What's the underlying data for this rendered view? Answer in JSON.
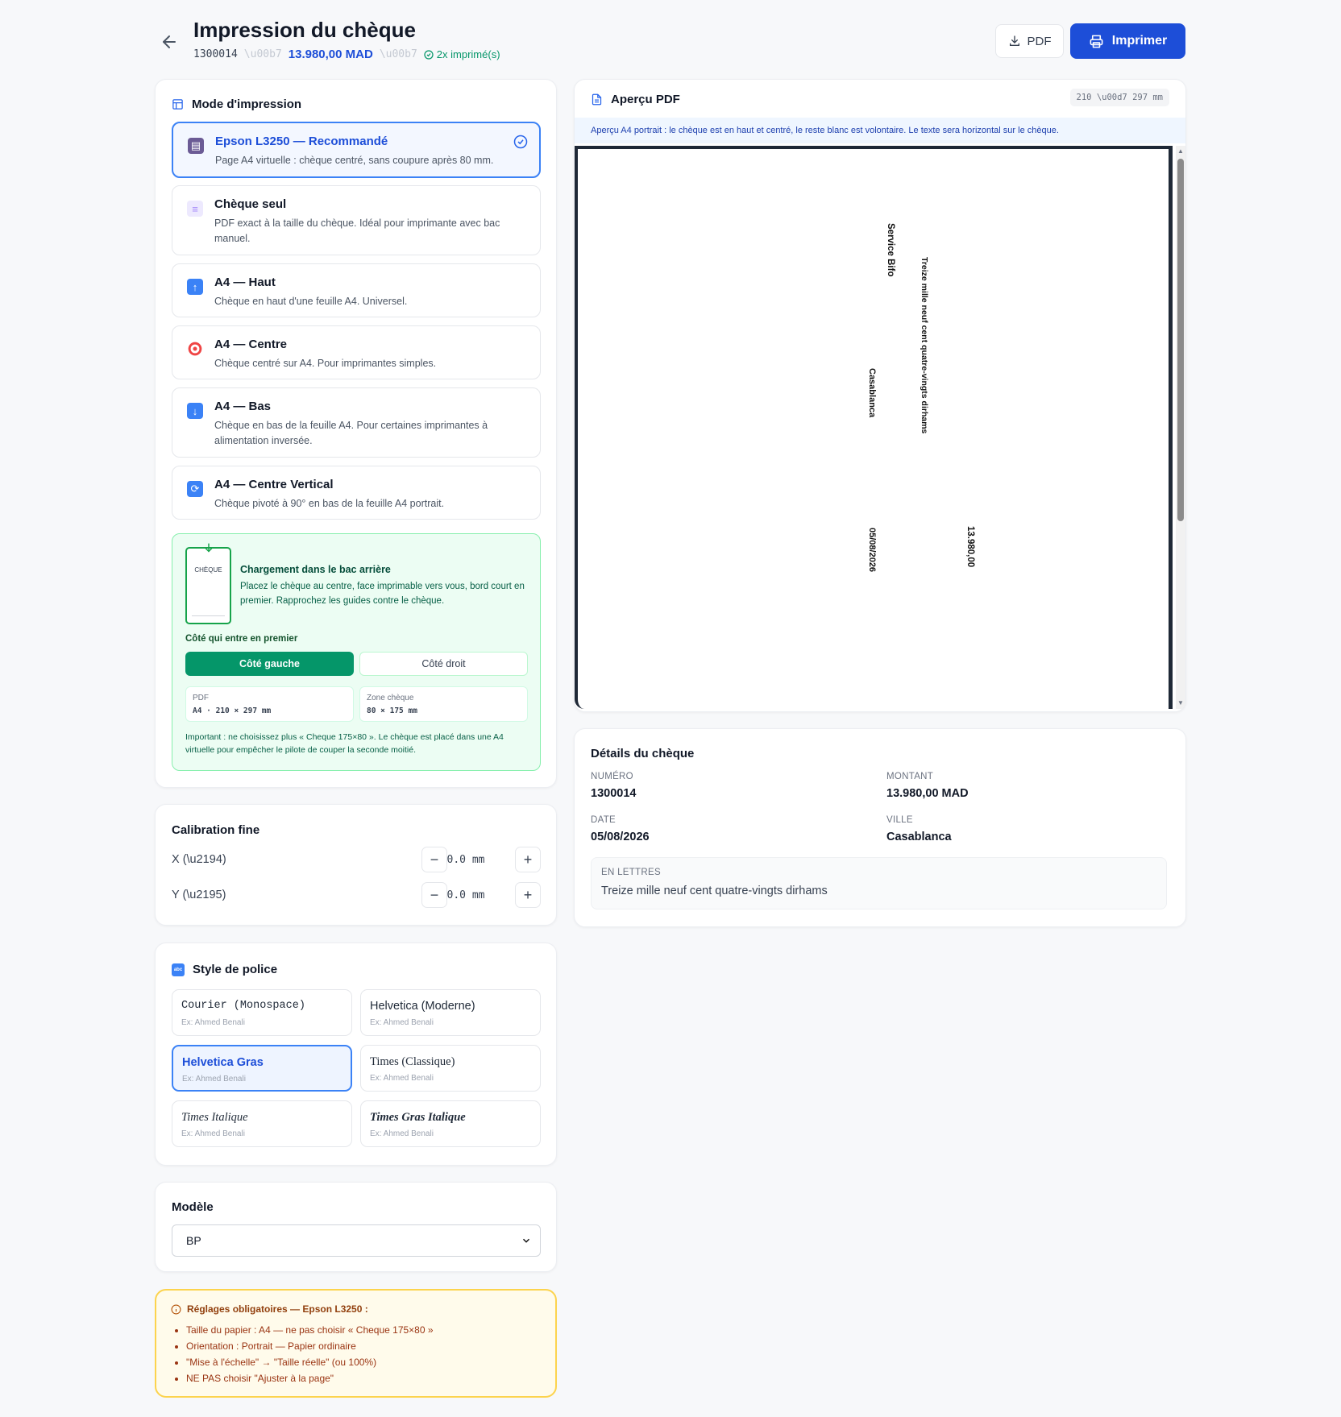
{
  "header": {
    "title": "Impression du chèque",
    "number": "1300014",
    "sep": "\\u00b7",
    "amount": "13.980,00 MAD",
    "printed": "2x imprimé(s)",
    "pdf_label": "PDF",
    "print_label": "Imprimer"
  },
  "mode": {
    "title": "Mode d'impression",
    "options": [
      {
        "title": "Epson L3250 — Recommandé",
        "desc": "Page A4 virtuelle : chèque centré, sans coupure après 80 mm.",
        "icon": "printer-icon"
      },
      {
        "title": "Chèque seul",
        "desc": "PDF exact à la taille du chèque. Idéal pour imprimante avec bac manuel.",
        "icon": "document-icon"
      },
      {
        "title": "A4 — Haut",
        "desc": "Chèque en haut d'une feuille A4. Universel.",
        "icon": "arrow-up-icon"
      },
      {
        "title": "A4 — Centre",
        "desc": "Chèque centré sur A4. Pour imprimantes simples.",
        "icon": "target-icon"
      },
      {
        "title": "A4 — Bas",
        "desc": "Chèque en bas de la feuille A4. Pour certaines imprimantes à alimentation inversée.",
        "icon": "arrow-down-icon"
      },
      {
        "title": "A4 — Centre Vertical",
        "desc": "Chèque pivoté à 90° en bas de la feuille A4 portrait.",
        "icon": "rotate-icon"
      }
    ],
    "loading": {
      "icon_label": "CHÈQUE",
      "title": "Chargement dans le bac arrière",
      "desc": "Placez le chèque au centre, face imprimable vers vous, bord court en premier. Rapprochez les guides contre le chèque.",
      "side_label": "Côté qui entre en premier",
      "left": "Côté gauche",
      "right": "Côté droit",
      "pdf_label": "PDF",
      "pdf_value": "A4 · 210 × 297 mm",
      "zone_label": "Zone chèque",
      "zone_value": "80 × 175 mm",
      "note": "Important : ne choisissez plus « Cheque 175×80 ». Le chèque est placé dans une A4 virtuelle pour empêcher le pilote de couper la seconde moitié."
    }
  },
  "calibration": {
    "title": "Calibration fine",
    "x_label": "X (\\u2194)",
    "x_value": "0.0 mm",
    "y_label": "Y (\\u2195)",
    "y_value": "0.0 mm",
    "minus": "−",
    "plus": "+"
  },
  "fonts": {
    "title": "Style de police",
    "example": "Ex: Ahmed Benali",
    "options": [
      "Courier (Monospace)",
      "Helvetica (Moderne)",
      "Helvetica Gras",
      "Times (Classique)",
      "Times Italique",
      "Times Gras Italique"
    ]
  },
  "model": {
    "title": "Modèle",
    "value": "BP"
  },
  "warning": {
    "title": "Réglages obligatoires — Epson L3250 :",
    "items": [
      "Taille du papier : A4 — ne pas choisir « Cheque 175×80 »",
      "Orientation : Portrait — Papier ordinaire",
      "\"Mise à l'échelle\" → \"Taille réelle\" (ou 100%)",
      "NE PAS choisir \"Ajuster à la page\""
    ]
  },
  "preview": {
    "title": "Aperçu PDF",
    "dims": "210 \\u00d7 297 mm",
    "info": "Aperçu A4 portrait : le chèque est en haut et centré, le reste blanc est volontaire. Le texte sera horizontal sur le chèque.",
    "payee": "Service Bifo",
    "words": "Treize mille neuf cent quatre-vingts dirhams",
    "city": "Casablanca",
    "date": "05/08/2026",
    "amount": "13.980,00"
  },
  "details": {
    "title": "Détails du chèque",
    "numero_label": "NUMÉRO",
    "numero": "1300014",
    "montant_label": "MONTANT",
    "montant": "13.980,00 MAD",
    "date_label": "DATE",
    "date": "05/08/2026",
    "ville_label": "VILLE",
    "ville": "Casablanca",
    "lettres_label": "EN LETTRES",
    "lettres": "Treize mille neuf cent quatre-vingts dirhams"
  },
  "colors": {
    "accent": "#1d4ed8",
    "success": "#059669",
    "warning_bg": "#fffbeb"
  }
}
